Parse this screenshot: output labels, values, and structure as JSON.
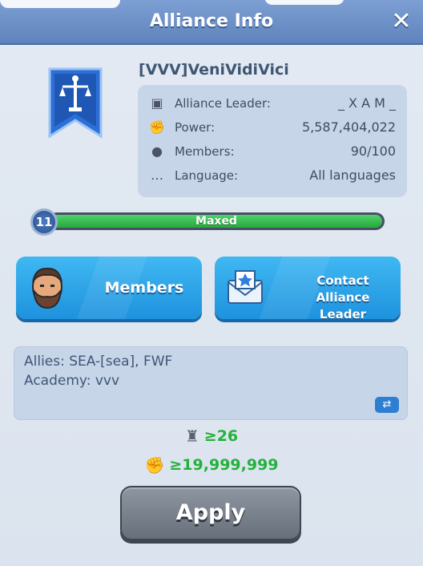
{
  "header": {
    "title": "Alliance Info",
    "close_glyph": "✕"
  },
  "alliance": {
    "name": "[VVV]VeniVidiVici",
    "emblem_icon": "justice-scales-banner-icon",
    "details": [
      {
        "icon": "leader-badge-icon",
        "label": "Alliance Leader:",
        "value": "_ X A M _"
      },
      {
        "icon": "fist-power-icon",
        "label": "Power:",
        "value": "5,587,404,022"
      },
      {
        "icon": "member-silhouette-icon",
        "label": "Members:",
        "value": "90/100"
      },
      {
        "icon": "speech-bubble-icon",
        "label": "Language:",
        "value": "All languages"
      }
    ]
  },
  "progress": {
    "level": "11",
    "label": "Maxed",
    "fill_fraction": 1.0
  },
  "buttons": {
    "members": "Members",
    "contact_line1": "Contact Alliance",
    "contact_line2": "Leader"
  },
  "allies_box": {
    "allies": "Allies: SEA-[sea], FWF",
    "academy": "Academy: vvv",
    "swap_glyph": "⇄"
  },
  "requirements": {
    "castle_level": "≥26",
    "power": "≥19,999,999"
  },
  "apply": "Apply",
  "colors": {
    "header": "#6b8fc8",
    "button_blue": "#2ea4ea",
    "progress_green": "#2fb448",
    "requirement_green": "#22b23a"
  }
}
